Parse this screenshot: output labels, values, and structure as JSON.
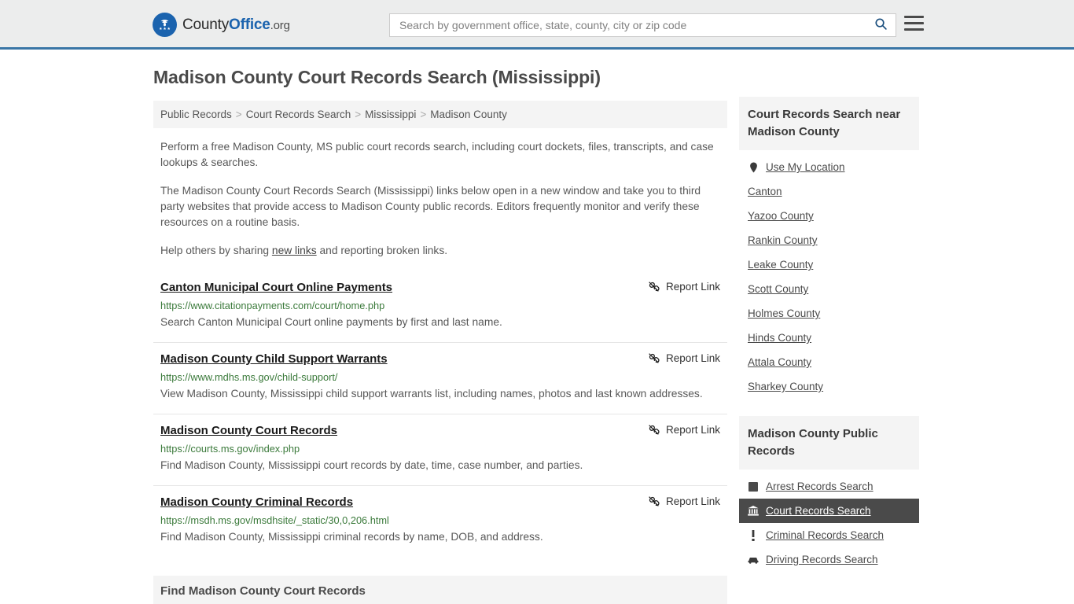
{
  "header": {
    "logo": {
      "prefix": "County",
      "bold": "Office",
      "suffix": ".org",
      "icon": "eagle-seal-icon"
    },
    "search": {
      "placeholder": "Search by government office, state, county, city or zip code",
      "value": "",
      "icon": "search-icon"
    },
    "menu_icon": "hamburger-menu-icon",
    "accent_color": "#3a76a6"
  },
  "main": {
    "title": "Madison County Court Records Search (Mississippi)",
    "breadcrumb": [
      {
        "label": "Public Records"
      },
      {
        "label": "Court Records Search"
      },
      {
        "label": "Mississippi"
      },
      {
        "label": "Madison County"
      }
    ],
    "breadcrumb_separator": ">",
    "intro": {
      "p1": "Perform a free Madison County, MS public court records search, including court dockets, files, transcripts, and case lookups & searches.",
      "p2": "The Madison County Court Records Search (Mississippi) links below open in a new window and take you to third party websites that provide access to Madison County public records. Editors frequently monitor and verify these resources on a routine basis.",
      "p3_before": "Help others by sharing ",
      "p3_link": "new links",
      "p3_after": " and reporting broken links."
    },
    "report_label": "Report Link",
    "report_icon": "broken-chain-icon",
    "links": [
      {
        "title": "Canton Municipal Court Online Payments",
        "url": "https://www.citationpayments.com/court/home.php",
        "description": "Search Canton Municipal Court online payments by first and last name."
      },
      {
        "title": "Madison County Child Support Warrants",
        "url": "https://www.mdhs.ms.gov/child-support/",
        "description": "View Madison County, Mississippi child support warrants list, including names, photos and last known addresses."
      },
      {
        "title": "Madison County Court Records",
        "url": "https://courts.ms.gov/index.php",
        "description": "Find Madison County, Mississippi court records by date, time, case number, and parties."
      },
      {
        "title": "Madison County Criminal Records",
        "url": "https://msdh.ms.gov/msdhsite/_static/30,0,206.html",
        "description": "Find Madison County, Mississippi criminal records by name, DOB, and address."
      }
    ],
    "section_heading": "Find Madison County Court Records"
  },
  "sidebar": {
    "nearby": {
      "heading": "Court Records Search near Madison County",
      "items": [
        {
          "label": "Use My Location",
          "icon": "map-pin-icon"
        },
        {
          "label": "Canton",
          "icon": ""
        },
        {
          "label": "Yazoo County",
          "icon": ""
        },
        {
          "label": "Rankin County",
          "icon": ""
        },
        {
          "label": "Leake County",
          "icon": ""
        },
        {
          "label": "Scott County",
          "icon": ""
        },
        {
          "label": "Holmes County",
          "icon": ""
        },
        {
          "label": "Hinds County",
          "icon": ""
        },
        {
          "label": "Attala County",
          "icon": ""
        },
        {
          "label": "Sharkey County",
          "icon": ""
        }
      ]
    },
    "public_records": {
      "heading": "Madison County Public Records",
      "items": [
        {
          "label": "Arrest Records Search",
          "icon": "square-badge-icon",
          "active": false
        },
        {
          "label": "Court Records Search",
          "icon": "courthouse-icon",
          "active": true
        },
        {
          "label": "Criminal Records Search",
          "icon": "exclamation-icon",
          "active": false
        },
        {
          "label": "Driving Records Search",
          "icon": "car-icon",
          "active": false
        }
      ]
    }
  }
}
